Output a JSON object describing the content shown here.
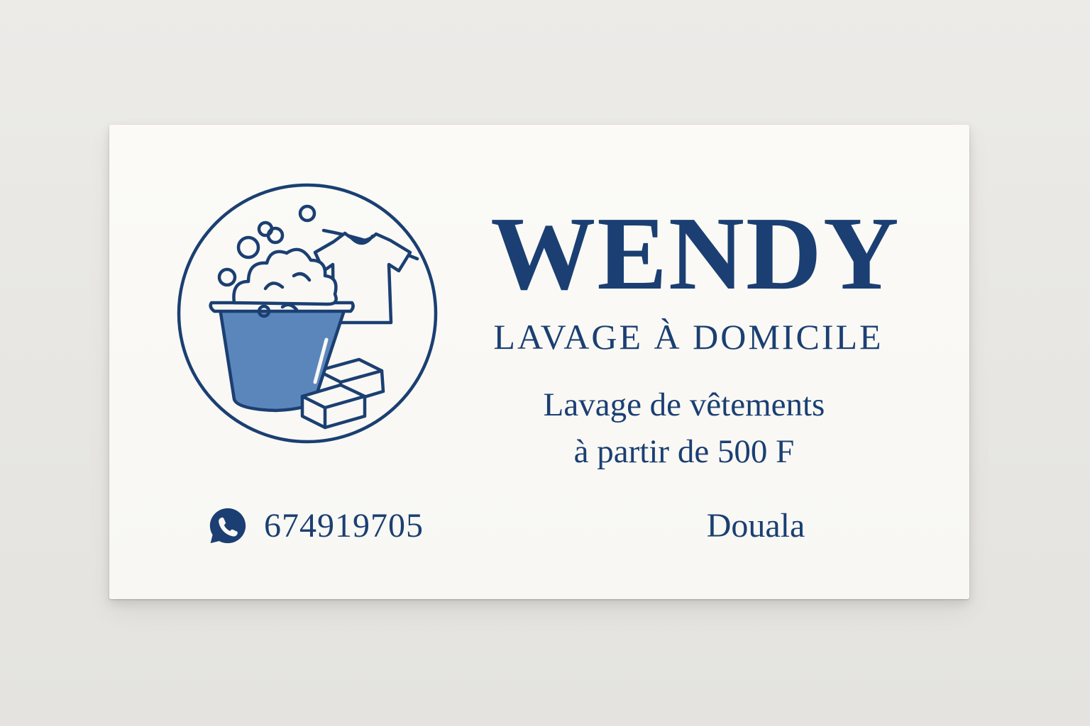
{
  "card": {
    "brand": "WENDY",
    "service": "LAVAGE À DOMICILE",
    "description": {
      "line1": "Lavage de vêtements",
      "line2": "à partir de 500 F"
    },
    "phone": "674919705",
    "city": "Douala"
  },
  "icons": {
    "logo": "laundry-bucket-soap-shirt-logo",
    "contact": "whatsapp-icon"
  },
  "colors": {
    "ink": "#1b3f72",
    "bucket_fill": "#5b86bb",
    "card": "#f9f8f4",
    "background": "#e8e7e3"
  }
}
